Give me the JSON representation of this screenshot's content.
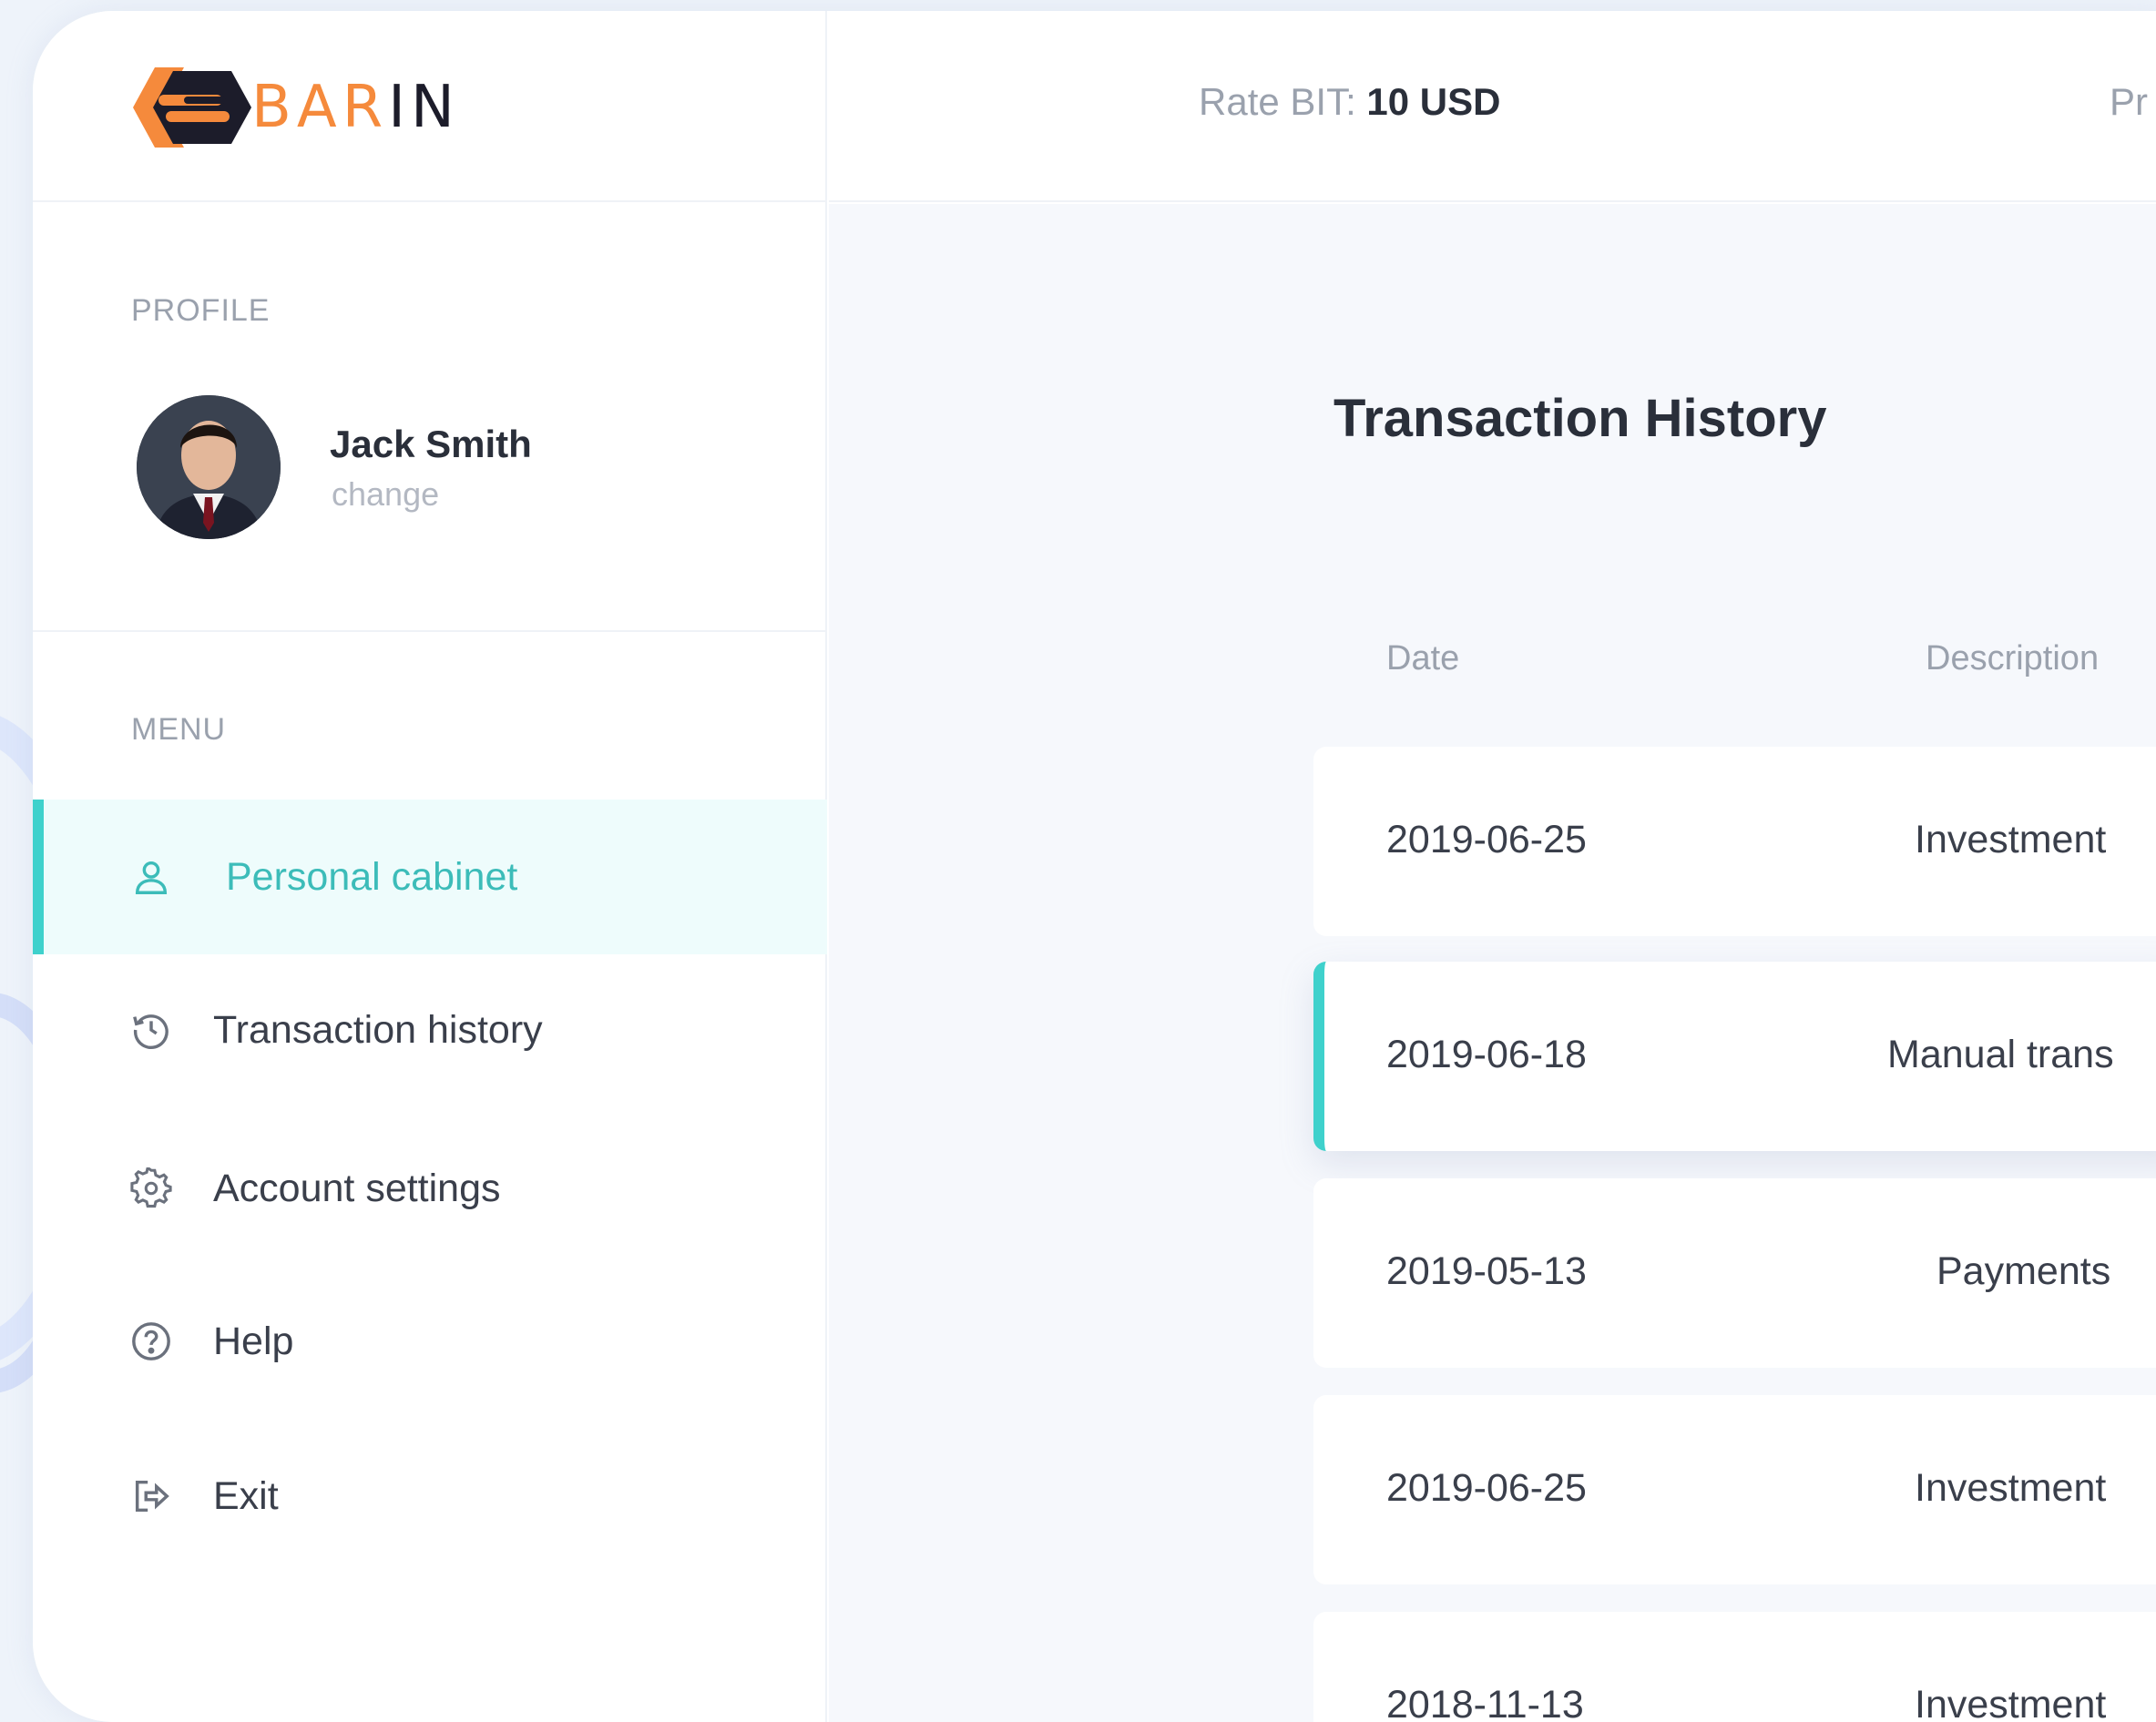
{
  "brand": {
    "name_colored": "BAR",
    "name_dark": "IN",
    "accent_color": "#3fd1cc",
    "logo_orange": "#f58a3c"
  },
  "topbar": {
    "rate_label": "Rate BIT:",
    "rate_value": "10 USD",
    "next_item_partial": "Pr"
  },
  "sidebar": {
    "profile_label": "PROFILE",
    "user": {
      "name": "Jack Smith",
      "change_link": "change"
    },
    "menu_label": "MENU",
    "items": [
      {
        "label": "Personal cabinet",
        "icon": "user-icon",
        "active": true
      },
      {
        "label": "Transaction history",
        "icon": "history-icon",
        "active": false
      },
      {
        "label": "Account settings",
        "icon": "gear-icon",
        "active": false
      },
      {
        "label": "Help",
        "icon": "help-circle-icon",
        "active": false
      },
      {
        "label": "Exit",
        "icon": "exit-icon",
        "active": false
      }
    ]
  },
  "main": {
    "title": "Transaction History",
    "columns": [
      "Date",
      "Description"
    ],
    "rows": [
      {
        "date": "2019-06-25",
        "description": "Investment"
      },
      {
        "date": "2019-06-18",
        "description": "Manual trans"
      },
      {
        "date": "2019-05-13",
        "description": "Payments"
      },
      {
        "date": "2019-06-25",
        "description": "Investment"
      },
      {
        "date": "2018-11-13",
        "description": "Investment"
      }
    ]
  }
}
